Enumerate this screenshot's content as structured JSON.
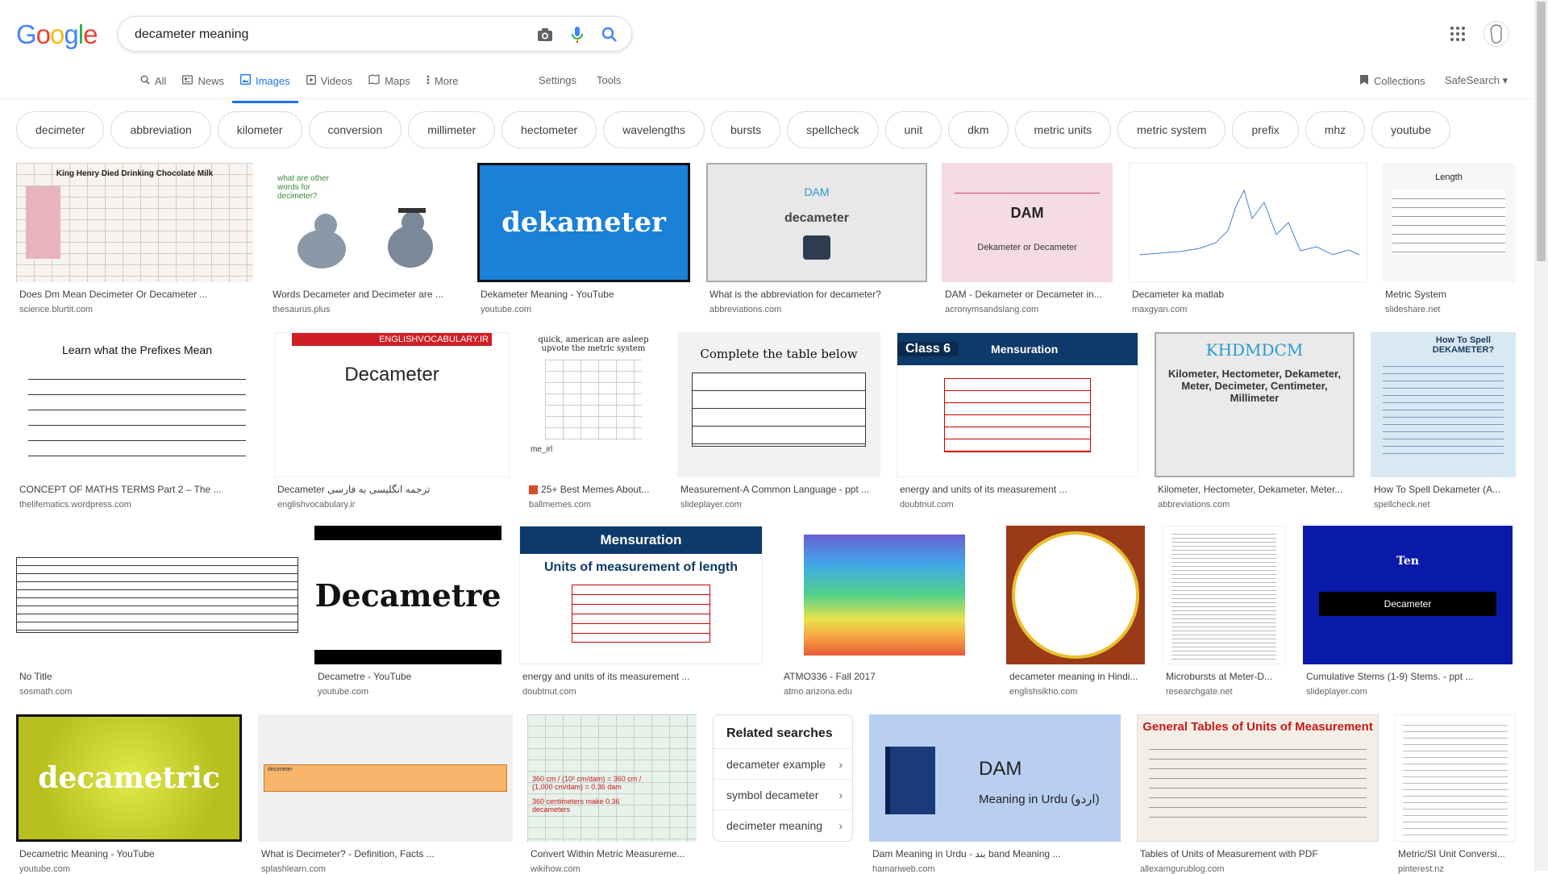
{
  "logo": {
    "letters": [
      "G",
      "o",
      "o",
      "g",
      "l",
      "e"
    ],
    "colors": [
      "#4285f4",
      "#ea4335",
      "#fbbc05",
      "#4285f4",
      "#34a853",
      "#ea4335"
    ]
  },
  "search": {
    "query": "decameter meaning"
  },
  "icons": {
    "camera": "camera-icon",
    "mic": "mic-icon",
    "search": "search-icon",
    "apps": "apps-grid-icon"
  },
  "tabs": [
    {
      "label": "All",
      "icon": "search-icon"
    },
    {
      "label": "News",
      "icon": "news-icon"
    },
    {
      "label": "Images",
      "icon": "image-icon",
      "active": true
    },
    {
      "label": "Videos",
      "icon": "video-icon"
    },
    {
      "label": "Maps",
      "icon": "map-icon"
    },
    {
      "label": "More",
      "icon": "more-icon"
    }
  ],
  "tools": {
    "settings": "Settings",
    "tools": "Tools"
  },
  "header_right": {
    "collections": "Collections",
    "safesearch": "SafeSearch"
  },
  "chips": [
    "decimeter",
    "abbreviation",
    "kilometer",
    "conversion",
    "millimeter",
    "hectometer",
    "wavelengths",
    "bursts",
    "spellcheck",
    "unit",
    "dkm",
    "metric units",
    "metric system",
    "prefix",
    "mhz",
    "youtube"
  ],
  "results": [
    {
      "caption": "Does Dm Mean Decimeter Or Decameter ...",
      "source": "science.blurtit.com",
      "thumb_text": "King Henry Died Drinking Chocolate Milk"
    },
    {
      "caption": "Words Decameter and Decimeter are ...",
      "source": "thesaurus.plus",
      "thumb_text": "what are other words for decimeter?"
    },
    {
      "caption": "Dekameter Meaning - YouTube",
      "source": "youtube.com",
      "thumb_text": "dekameter"
    },
    {
      "caption": "What is the abbreviation for decameter?",
      "source": "abbreviations.com",
      "thumb_text": "decameter",
      "thumb_sub": "DAM"
    },
    {
      "caption": "DAM - Dekameter or Decameter in...",
      "source": "acronymsandslang.com",
      "thumb_text": "DAM",
      "thumb_sub": "Dekameter or Decameter"
    },
    {
      "caption": "Decameter ka matlab",
      "source": "maxgyan.com",
      "thumb_text": ""
    },
    {
      "caption": "Metric System",
      "source": "slideshare.net",
      "thumb_text": "Length"
    },
    {
      "caption": "CONCEPT OF MATHS TERMS Part 2 – The ...",
      "source": "thelifematics.wordpress.com",
      "thumb_text": "Learn what the Prefixes Mean"
    },
    {
      "caption": "Decameter ترجمه انگلیسی به فارسی",
      "source": "englishvocabulary.ir",
      "thumb_text": "Decameter",
      "thumb_sub": "ENGLISHVOCABULARY.IR"
    },
    {
      "caption": "25+ Best Memes About...",
      "source": "ballmemes.com",
      "thumb_text": "quick, american are asleep upvote the metric system",
      "thumb_sub": "me_irl"
    },
    {
      "caption": "Measurement-A Common Language - ppt ...",
      "source": "slideplayer.com",
      "thumb_text": "Complete the table below"
    },
    {
      "caption": "energy and units of its measurement ...",
      "source": "doubtnut.com",
      "thumb_text": "Mensuration",
      "thumb_sub": "Class 6"
    },
    {
      "caption": "Kilometer, Hectometer, Dekameter, Meter...",
      "source": "abbreviations.com",
      "thumb_text": "KHDMDCM",
      "thumb_sub": "Kilometer, Hectometer, Dekameter, Meter, Decimeter, Centimeter, Millimeter"
    },
    {
      "caption": "How To Spell Dekameter (A...",
      "source": "spellcheck.net",
      "thumb_text": "How To Spell DEKAMETER?"
    },
    {
      "caption": "No Title",
      "source": "sosmath.com",
      "thumb_text": ""
    },
    {
      "caption": "Decametre - YouTube",
      "source": "youtube.com",
      "thumb_text": "Decametre"
    },
    {
      "caption": "energy and units of its measurement ...",
      "source": "doubtnut.com",
      "thumb_text": "Units of measurement of length",
      "thumb_sub": "Mensuration"
    },
    {
      "caption": "ATMO336 - Fall 2017",
      "source": "atmo.arizona.edu",
      "thumb_text": ""
    },
    {
      "caption": "decameter meaning in Hindi...",
      "source": "englishsikho.com",
      "thumb_text": ""
    },
    {
      "caption": "Microbursts at Meter-D...",
      "source": "researchgate.net",
      "thumb_text": ""
    },
    {
      "caption": "Cumulative Stems (1-9) Stems. - ppt ...",
      "source": "slideplayer.com",
      "thumb_text": "Ten",
      "thumb_sub": "Decameter"
    },
    {
      "caption": "Decametric Meaning - YouTube",
      "source": "youtube.com",
      "thumb_text": "decametric"
    },
    {
      "caption": "What is Decimeter? - Definition, Facts ...",
      "source": "splashlearn.com",
      "thumb_text": "decimeter"
    },
    {
      "caption": "Convert Within Metric Measureme...",
      "source": "wikihow.com",
      "thumb_text": "360 cm / (10² cm/dam) = 360 cm / (1,000 cm/dam) = 0.36 dam",
      "thumb_sub": "360 centimeters make 0.36 decameters"
    },
    {
      "caption": "Dam Meaning in Urdu - بند band Meaning ...",
      "source": "hamariweb.com",
      "thumb_text": "DAM",
      "thumb_sub": "Meaning in Urdu (اردو)"
    },
    {
      "caption": "Tables of Units of Measurement with PDF",
      "source": "allexamgurublog.com",
      "thumb_text": "General Tables of Units of Measurement"
    },
    {
      "caption": "Metric/SI Unit Conversi...",
      "source": "pinterest.nz",
      "thumb_text": ""
    }
  ],
  "related": {
    "title": "Related searches",
    "items": [
      "decameter example",
      "symbol decameter",
      "decimeter meaning"
    ]
  }
}
